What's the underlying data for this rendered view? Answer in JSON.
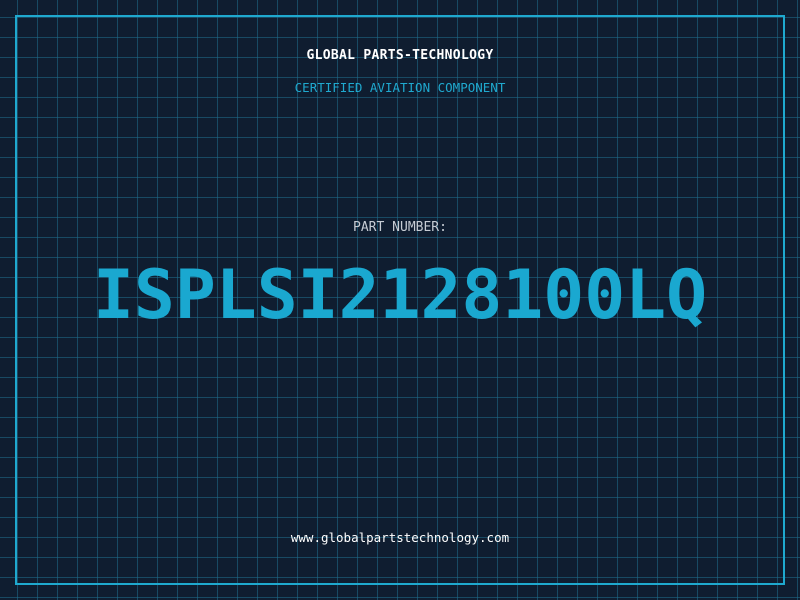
{
  "header": {
    "company": "GLOBAL PARTS-TECHNOLOGY",
    "tagline": "CERTIFIED AVIATION COMPONENT"
  },
  "part": {
    "label": "PART NUMBER:",
    "number": "ISPLSI2128100LQ"
  },
  "footer": {
    "website": "www.globalpartstechnology.com"
  },
  "colors": {
    "background": "#0f1d30",
    "accent": "#1fa9cf",
    "part_number": "#1aa8d0",
    "text": "#ffffff",
    "label": "#c6ccd4"
  }
}
